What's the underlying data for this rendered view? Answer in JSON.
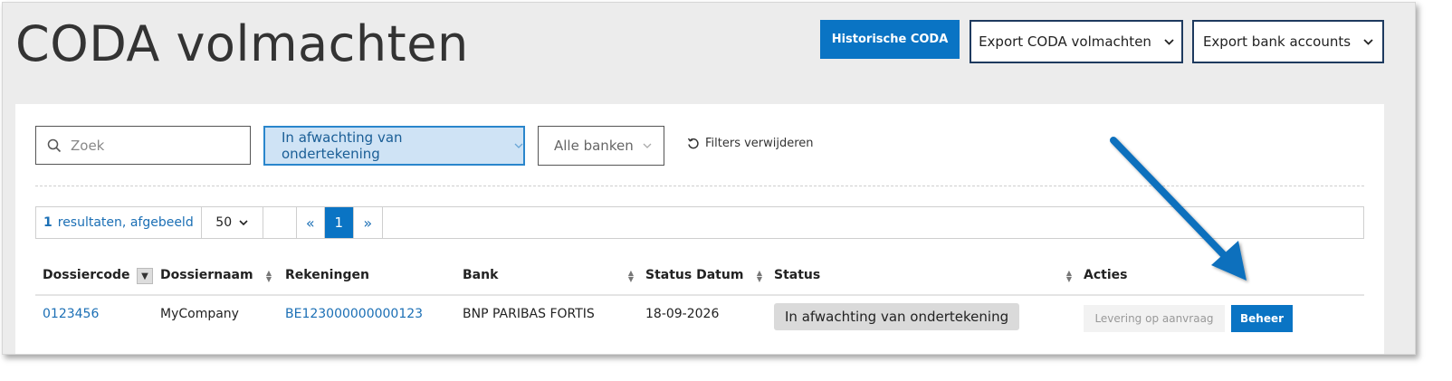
{
  "header": {
    "title": "CODA volmachten",
    "buttons": {
      "historic": "Historische CODA",
      "export_coda": "Export CODA volmachten",
      "export_bank": "Export bank accounts"
    }
  },
  "filters": {
    "search_placeholder": "Zoek",
    "status_filter": "In afwachting van ondertekening",
    "bank_filter": "Alle banken",
    "clear_filters": "Filters verwijderen"
  },
  "pagination": {
    "results_count": "1",
    "results_label": "resultaten, afgebeeld",
    "page_size": "50",
    "first": "«",
    "current_page": "1",
    "next": "»"
  },
  "table": {
    "columns": [
      "Dossiercode",
      "Dossiernaam",
      "Rekeningen",
      "Bank",
      "Status Datum",
      "Status",
      "Acties"
    ],
    "rows": [
      {
        "dossiercode": "0123456",
        "dossiernaam": "MyCompany",
        "rekeningen": "BE123000000000123",
        "bank": "BNP PARIBAS FORTIS",
        "status_datum": "18-09-2026",
        "status": "In afwachting van ondertekening",
        "action_delivery": "Levering op aanvraag",
        "action_manage": "Beheer"
      }
    ]
  },
  "colors": {
    "primary": "#0a74c4",
    "annotation_arrow": "#0b6fbd"
  }
}
